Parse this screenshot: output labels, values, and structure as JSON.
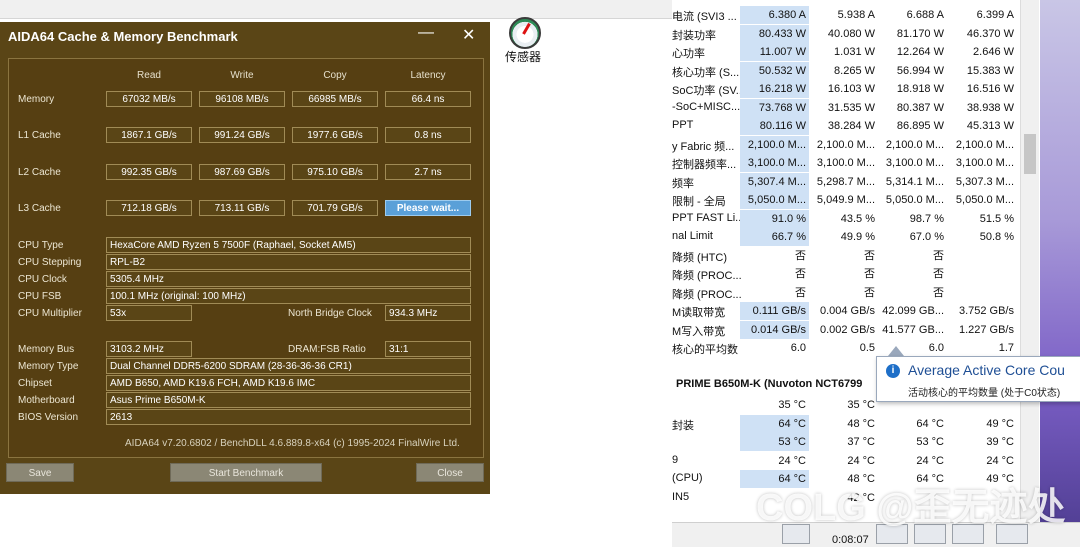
{
  "desktop": {
    "sensor_label": "传感器"
  },
  "aida": {
    "title": "AIDA64 Cache & Memory Benchmark",
    "min_glyph": "—",
    "close_glyph": "✕",
    "headers": [
      "Read",
      "Write",
      "Copy",
      "Latency"
    ],
    "rows": [
      {
        "label": "Memory",
        "read": "67032 MB/s",
        "write": "96108 MB/s",
        "copy": "66985 MB/s",
        "latency": "66.4 ns"
      },
      {
        "label": "L1 Cache",
        "read": "1867.1 GB/s",
        "write": "991.24 GB/s",
        "copy": "1977.6 GB/s",
        "latency": "0.8 ns"
      },
      {
        "label": "L2 Cache",
        "read": "992.35 GB/s",
        "write": "987.69 GB/s",
        "copy": "975.10 GB/s",
        "latency": "2.7 ns"
      },
      {
        "label": "L3 Cache",
        "read": "712.18 GB/s",
        "write": "713.11 GB/s",
        "copy": "701.79 GB/s",
        "latency": "Please wait..."
      }
    ],
    "cpu_type_label": "CPU Type",
    "cpu_type": "HexaCore AMD Ryzen 5 7500F  (Raphael, Socket AM5)",
    "cpu_stepping_label": "CPU Stepping",
    "cpu_stepping": "RPL-B2",
    "cpu_clock_label": "CPU Clock",
    "cpu_clock": "5305.4 MHz",
    "cpu_fsb_label": "CPU FSB",
    "cpu_fsb": "100.1 MHz  (original: 100 MHz)",
    "cpu_mult_label": "CPU Multiplier",
    "cpu_mult": "53x",
    "nb_clock_label": "North Bridge Clock",
    "nb_clock": "934.3 MHz",
    "mem_bus_label": "Memory Bus",
    "mem_bus": "3103.2 MHz",
    "dram_ratio_label": "DRAM:FSB Ratio",
    "dram_ratio": "31:1",
    "mem_type_label": "Memory Type",
    "mem_type": "Dual Channel DDR5-6200 SDRAM  (28-36-36-36 CR1)",
    "chipset_label": "Chipset",
    "chipset": "AMD B650, AMD K19.6 FCH, AMD K19.6 IMC",
    "mobo_label": "Motherboard",
    "mobo": "Asus Prime B650M-K",
    "bios_label": "BIOS Version",
    "bios": "2613",
    "footer": "AIDA64 v7.20.6802 / BenchDLL 4.6.889.8-x64  (c) 1995-2024 FinalWire Ltd.",
    "save_label": "Save",
    "start_label": "Start Benchmark",
    "close_label": "Close"
  },
  "hwinfo": {
    "rows": [
      {
        "label": "电流 (SVI3 ...",
        "cur": "6.380 A",
        "min": "5.938 A",
        "max": "6.688 A",
        "avg": "6.399 A",
        "hl": true
      },
      {
        "label": "封装功率",
        "cur": "80.433 W",
        "min": "40.080 W",
        "max": "81.170 W",
        "avg": "46.370 W",
        "hl": true
      },
      {
        "label": "心功率",
        "cur": "11.007 W",
        "min": "1.031 W",
        "max": "12.264 W",
        "avg": "2.646 W",
        "hl": true
      },
      {
        "label": "核心功率 (S...",
        "cur": "50.532 W",
        "min": "8.265 W",
        "max": "56.994 W",
        "avg": "15.383 W",
        "hl": true
      },
      {
        "label": "SoC功率 (SV...",
        "cur": "16.218 W",
        "min": "16.103 W",
        "max": "18.918 W",
        "avg": "16.516 W",
        "hl": true
      },
      {
        "label": "-SoC+MISC...",
        "cur": "73.768 W",
        "min": "31.535 W",
        "max": "80.387 W",
        "avg": "38.938 W",
        "hl": true
      },
      {
        "label": "PPT",
        "cur": "80.116 W",
        "min": "38.284 W",
        "max": "86.895 W",
        "avg": "45.313 W",
        "hl": true
      },
      {
        "label": "y Fabric 频...",
        "cur": "2,100.0 M...",
        "min": "2,100.0 M...",
        "max": "2,100.0 M...",
        "avg": "2,100.0 M...",
        "hl": true
      },
      {
        "label": "控制器频率...",
        "cur": "3,100.0 M...",
        "min": "3,100.0 M...",
        "max": "3,100.0 M...",
        "avg": "3,100.0 M...",
        "hl": true
      },
      {
        "label": "频率",
        "cur": "5,307.4 M...",
        "min": "5,298.7 M...",
        "max": "5,314.1 M...",
        "avg": "5,307.3 M...",
        "hl": true
      },
      {
        "label": "限制 - 全局",
        "cur": "5,050.0 M...",
        "min": "5,049.9 M...",
        "max": "5,050.0 M...",
        "avg": "5,050.0 M...",
        "hl": true
      },
      {
        "label": "PPT FAST Li...",
        "cur": "91.0 %",
        "min": "43.5 %",
        "max": "98.7 %",
        "avg": "51.5 %",
        "hl": true
      },
      {
        "label": "nal Limit",
        "cur": "66.7 %",
        "min": "49.9 %",
        "max": "67.0 %",
        "avg": "50.8 %",
        "hl": true
      },
      {
        "label": "降频 (HTC)",
        "cur": "否",
        "min": "否",
        "max": "否",
        "avg": "",
        "hl": false
      },
      {
        "label": "降频 (PROC...",
        "cur": "否",
        "min": "否",
        "max": "否",
        "avg": "",
        "hl": false
      },
      {
        "label": "降频 (PROC...",
        "cur": "否",
        "min": "否",
        "max": "否",
        "avg": "",
        "hl": false
      },
      {
        "label": "M读取带宽",
        "cur": "0.111 GB/s",
        "min": "0.004 GB/s",
        "max": "42.099 GB...",
        "avg": "3.752 GB/s",
        "hl": true
      },
      {
        "label": "M写入带宽",
        "cur": "0.014 GB/s",
        "min": "0.002 GB/s",
        "max": "41.577 GB...",
        "avg": "1.227 GB/s",
        "hl": true
      },
      {
        "label": "核心的平均数",
        "cur": "6.0",
        "min": "0.5",
        "max": "6.0",
        "avg": "1.7",
        "hl": false
      }
    ],
    "section_header": "PRIME B650M-K (Nuvoton NCT6799",
    "temp_rows": [
      {
        "label": "",
        "cur": "35 °C",
        "min": "35 °C",
        "max": "",
        "avg": "",
        "hl": false
      },
      {
        "label": "封装",
        "cur": "64 °C",
        "min": "48 °C",
        "max": "64 °C",
        "avg": "49 °C",
        "hl": true
      },
      {
        "label": "",
        "cur": "53 °C",
        "min": "37 °C",
        "max": "53 °C",
        "avg": "39 °C",
        "hl": true
      },
      {
        "label": "9",
        "cur": "24 °C",
        "min": "24 °C",
        "max": "24 °C",
        "avg": "24 °C",
        "hl": false
      },
      {
        "label": "(CPU)",
        "cur": "64 °C",
        "min": "48 °C",
        "max": "64 °C",
        "avg": "49 °C",
        "hl": true
      },
      {
        "label": "IN5",
        "cur": "",
        "min": "42 °C",
        "max": "",
        "avg": "",
        "hl": false
      }
    ],
    "tooltip_title": "Average Active Core Cou",
    "tooltip_sub": "活动核心的平均数量 (处于C0状态)",
    "timer": "0:08:07",
    "watermark": "COLG @歪无迹处"
  },
  "colors": {
    "aida_bg": "#5a4516",
    "accent": "#5aa0d8",
    "highlight": "#cfe1f5"
  }
}
